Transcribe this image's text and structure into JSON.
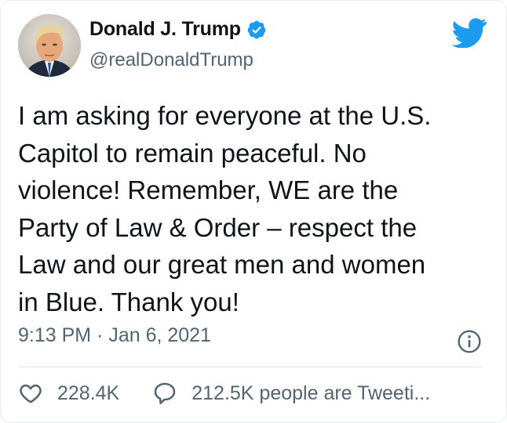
{
  "user": {
    "display_name": "Donald J. Trump",
    "handle": "@realDonaldTrump",
    "verified": true
  },
  "tweet": {
    "lines": [
      "I am asking for everyone at the U.S.",
      "Capitol to remain peaceful. No",
      "violence! Remember, WE are the",
      "Party of Law & Order – respect the",
      "Law and our great men and women",
      "in Blue. Thank you!"
    ],
    "timestamp": "9:13 PM · Jan 6, 2021"
  },
  "actions": {
    "likes": "228.4K",
    "talking": "212.5K people are Tweeti..."
  },
  "icons": {
    "brand": "twitter-bird-icon",
    "verified": "verified-badge-icon",
    "info": "info-icon",
    "like": "heart-icon",
    "reply": "speech-bubble-icon"
  },
  "colors": {
    "brand_blue": "#1d9bf0",
    "text_primary": "#0f1419",
    "text_secondary": "#536471"
  }
}
